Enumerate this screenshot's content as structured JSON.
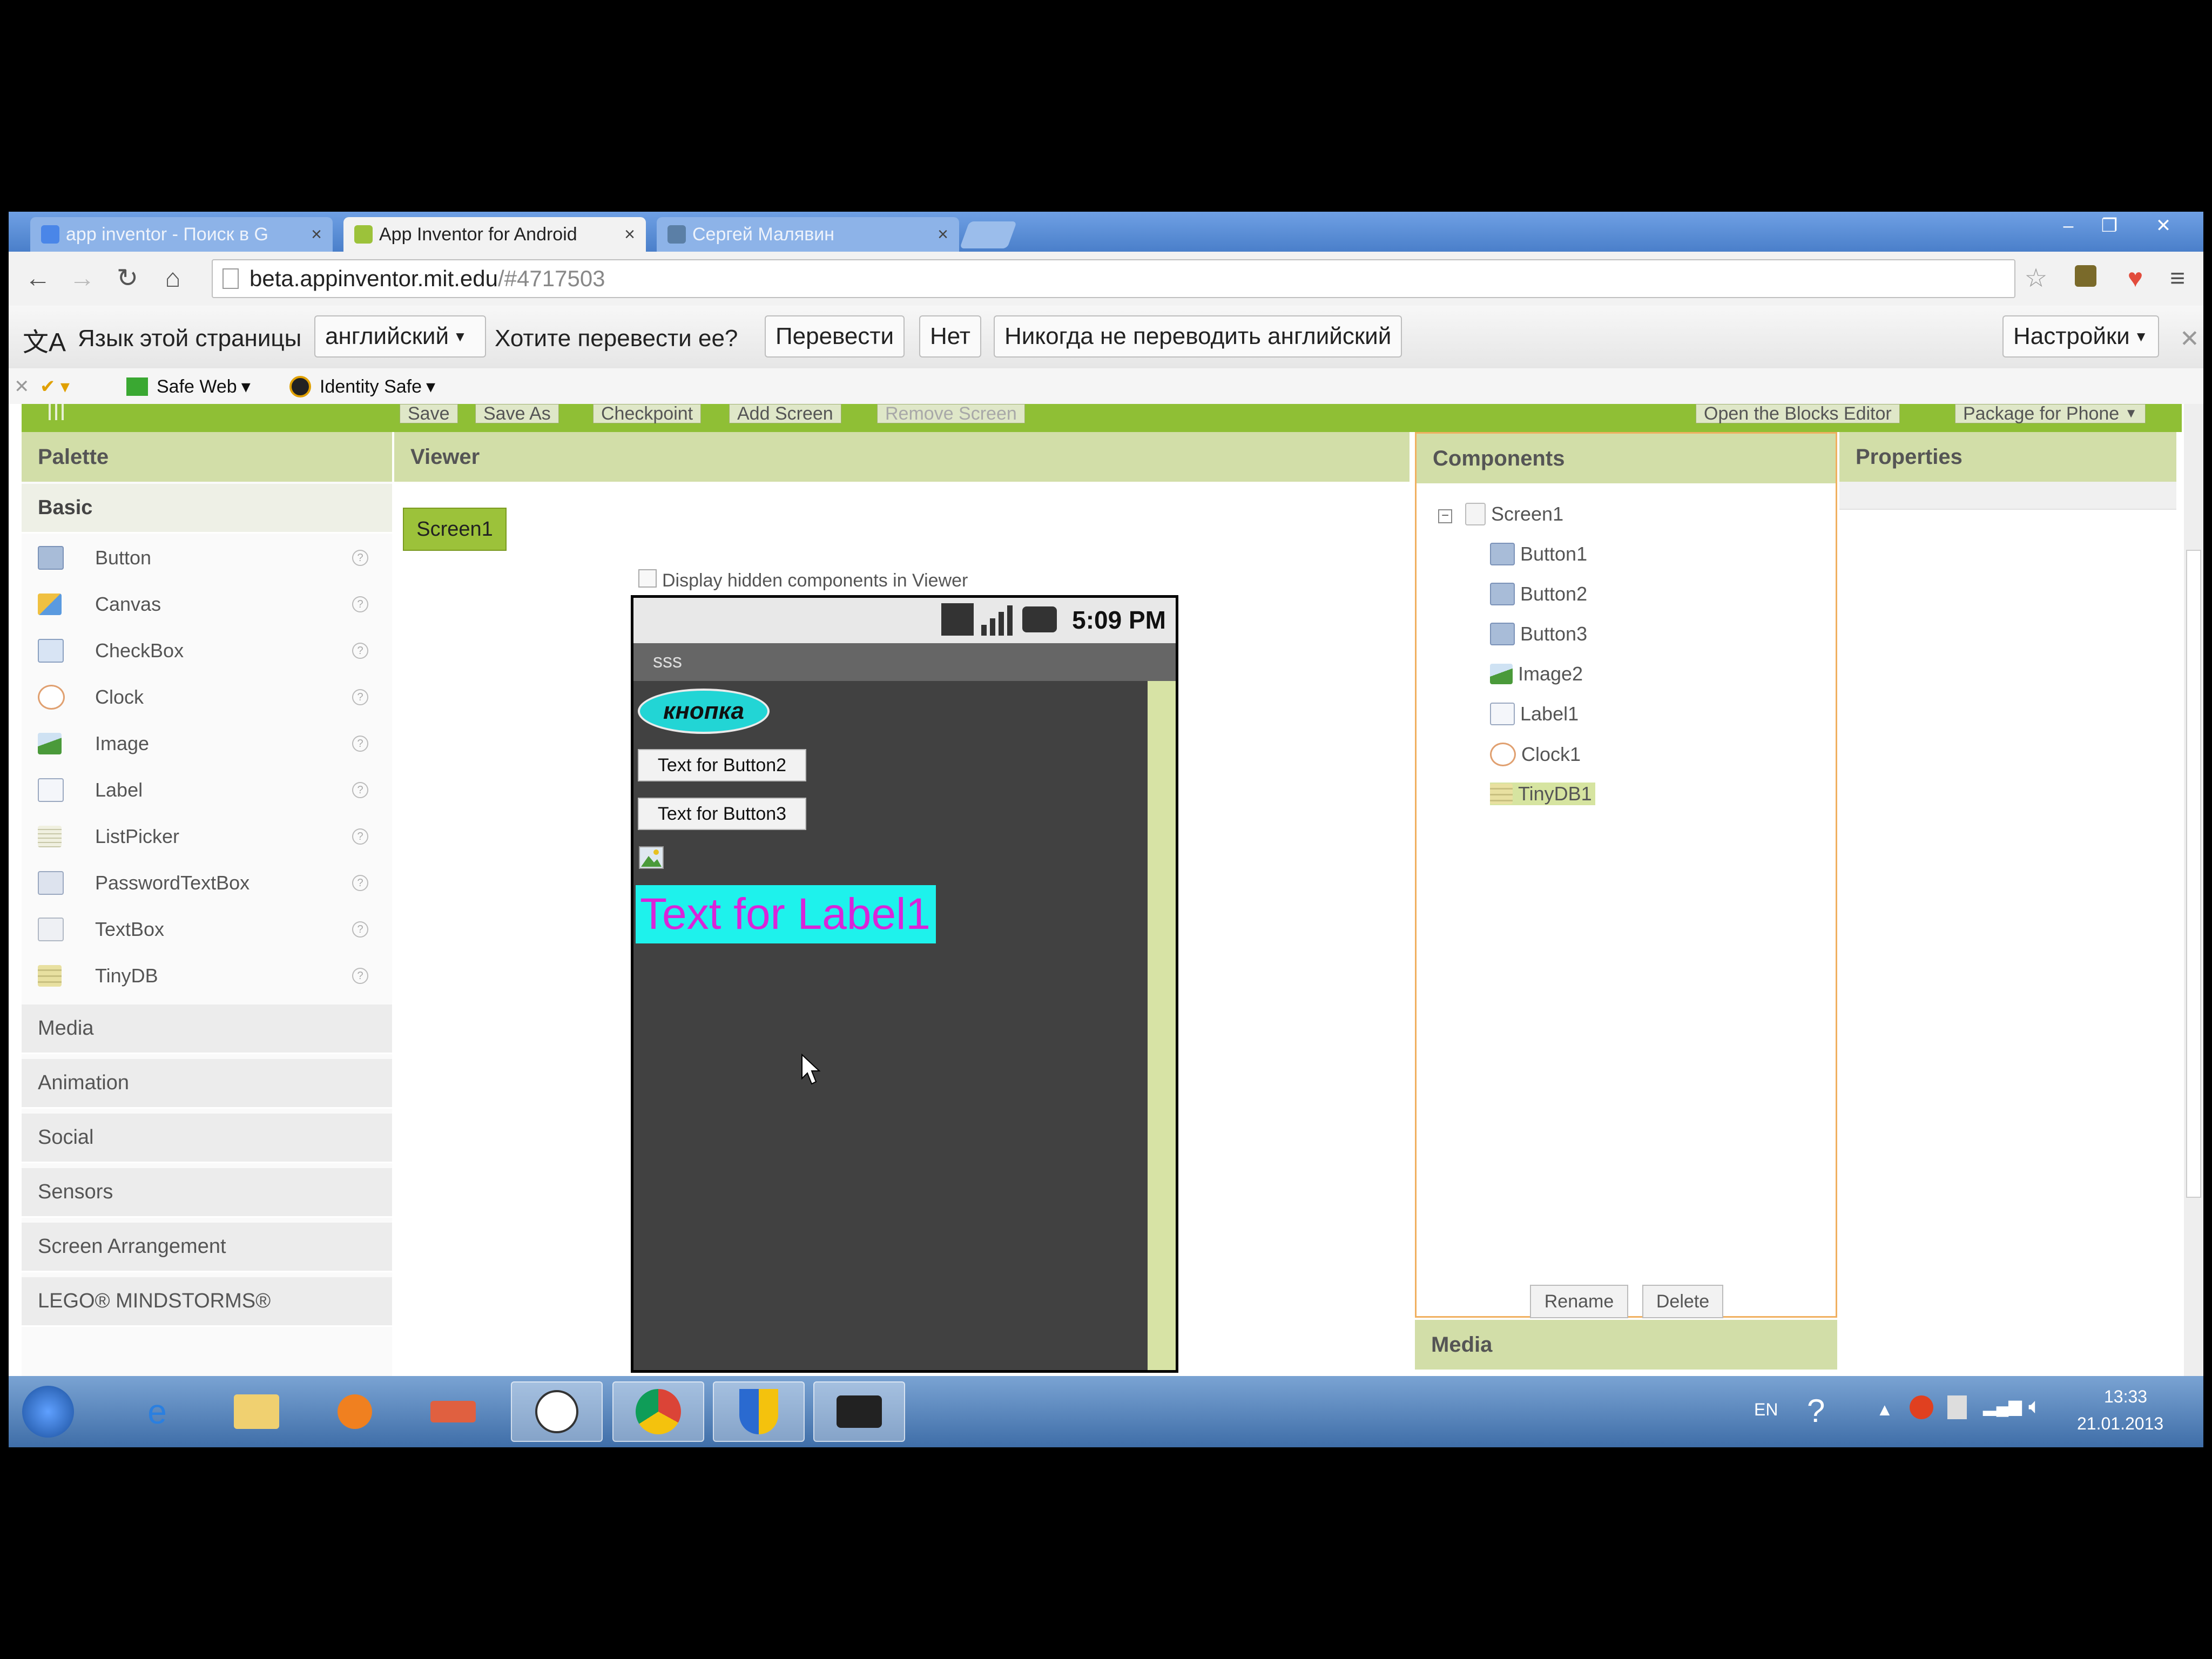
{
  "browser": {
    "tabs": [
      {
        "label": "app inventor - Поиск в G",
        "active": false
      },
      {
        "label": "App Inventor for Android",
        "active": true
      },
      {
        "label": "Сергей Малявин",
        "active": false
      }
    ],
    "url_host": "beta.appinventor.mit.edu",
    "url_path": "/#4717503"
  },
  "translate_bar": {
    "lang_prefix": "Язык этой страницы",
    "lang_value": "английский",
    "question": "Хотите перевести ее?",
    "translate": "Перевести",
    "no": "Нет",
    "never": "Никогда не переводить английский",
    "settings": "Настройки"
  },
  "bookmarks": {
    "safe_web": "Safe Web",
    "identity_safe": "Identity Safe"
  },
  "toolbar": {
    "save": "Save",
    "save_as": "Save As",
    "checkpoint": "Checkpoint",
    "add_screen": "Add Screen",
    "remove_screen": "Remove Screen",
    "blocks_editor": "Open the Blocks Editor",
    "package": "Package for Phone"
  },
  "palette": {
    "title": "Palette",
    "basic_label": "Basic",
    "items": [
      {
        "label": "Button",
        "icon": "button-icon"
      },
      {
        "label": "Canvas",
        "icon": "canvas-icon"
      },
      {
        "label": "CheckBox",
        "icon": "checkbox-icon"
      },
      {
        "label": "Clock",
        "icon": "clock-icon"
      },
      {
        "label": "Image",
        "icon": "image-icon"
      },
      {
        "label": "Label",
        "icon": "label-icon"
      },
      {
        "label": "ListPicker",
        "icon": "listpicker-icon"
      },
      {
        "label": "PasswordTextBox",
        "icon": "password-icon"
      },
      {
        "label": "TextBox",
        "icon": "textbox-icon"
      },
      {
        "label": "TinyDB",
        "icon": "tinydb-icon"
      }
    ],
    "categories": [
      "Media",
      "Animation",
      "Social",
      "Sensors",
      "Screen Arrangement",
      "LEGO® MINDSTORMS®"
    ]
  },
  "viewer": {
    "title": "Viewer",
    "screen_button": "Screen1",
    "hidden_checkbox_label": "Display hidden components in Viewer",
    "phone": {
      "time": "5:09 PM",
      "app_title": "sss",
      "button1": "кнопка",
      "button2": "Text for Button2",
      "button3": "Text for Button3",
      "label1": "Text for Label1"
    }
  },
  "components": {
    "title": "Components",
    "root": "Screen1",
    "items": [
      "Button1",
      "Button2",
      "Button3",
      "Image2",
      "Label1",
      "Clock1",
      "TinyDB1"
    ],
    "selected": "TinyDB1",
    "rename": "Rename",
    "delete": "Delete",
    "media_title": "Media"
  },
  "properties": {
    "title": "Properties"
  },
  "taskbar": {
    "lang": "EN",
    "time": "13:33",
    "date": "21.01.2013"
  },
  "colors": {
    "accent_green": "#8fbf35",
    "panel_header": "#d2dea8",
    "label_bg": "#1ef2ec",
    "label_text": "#d924d9"
  }
}
